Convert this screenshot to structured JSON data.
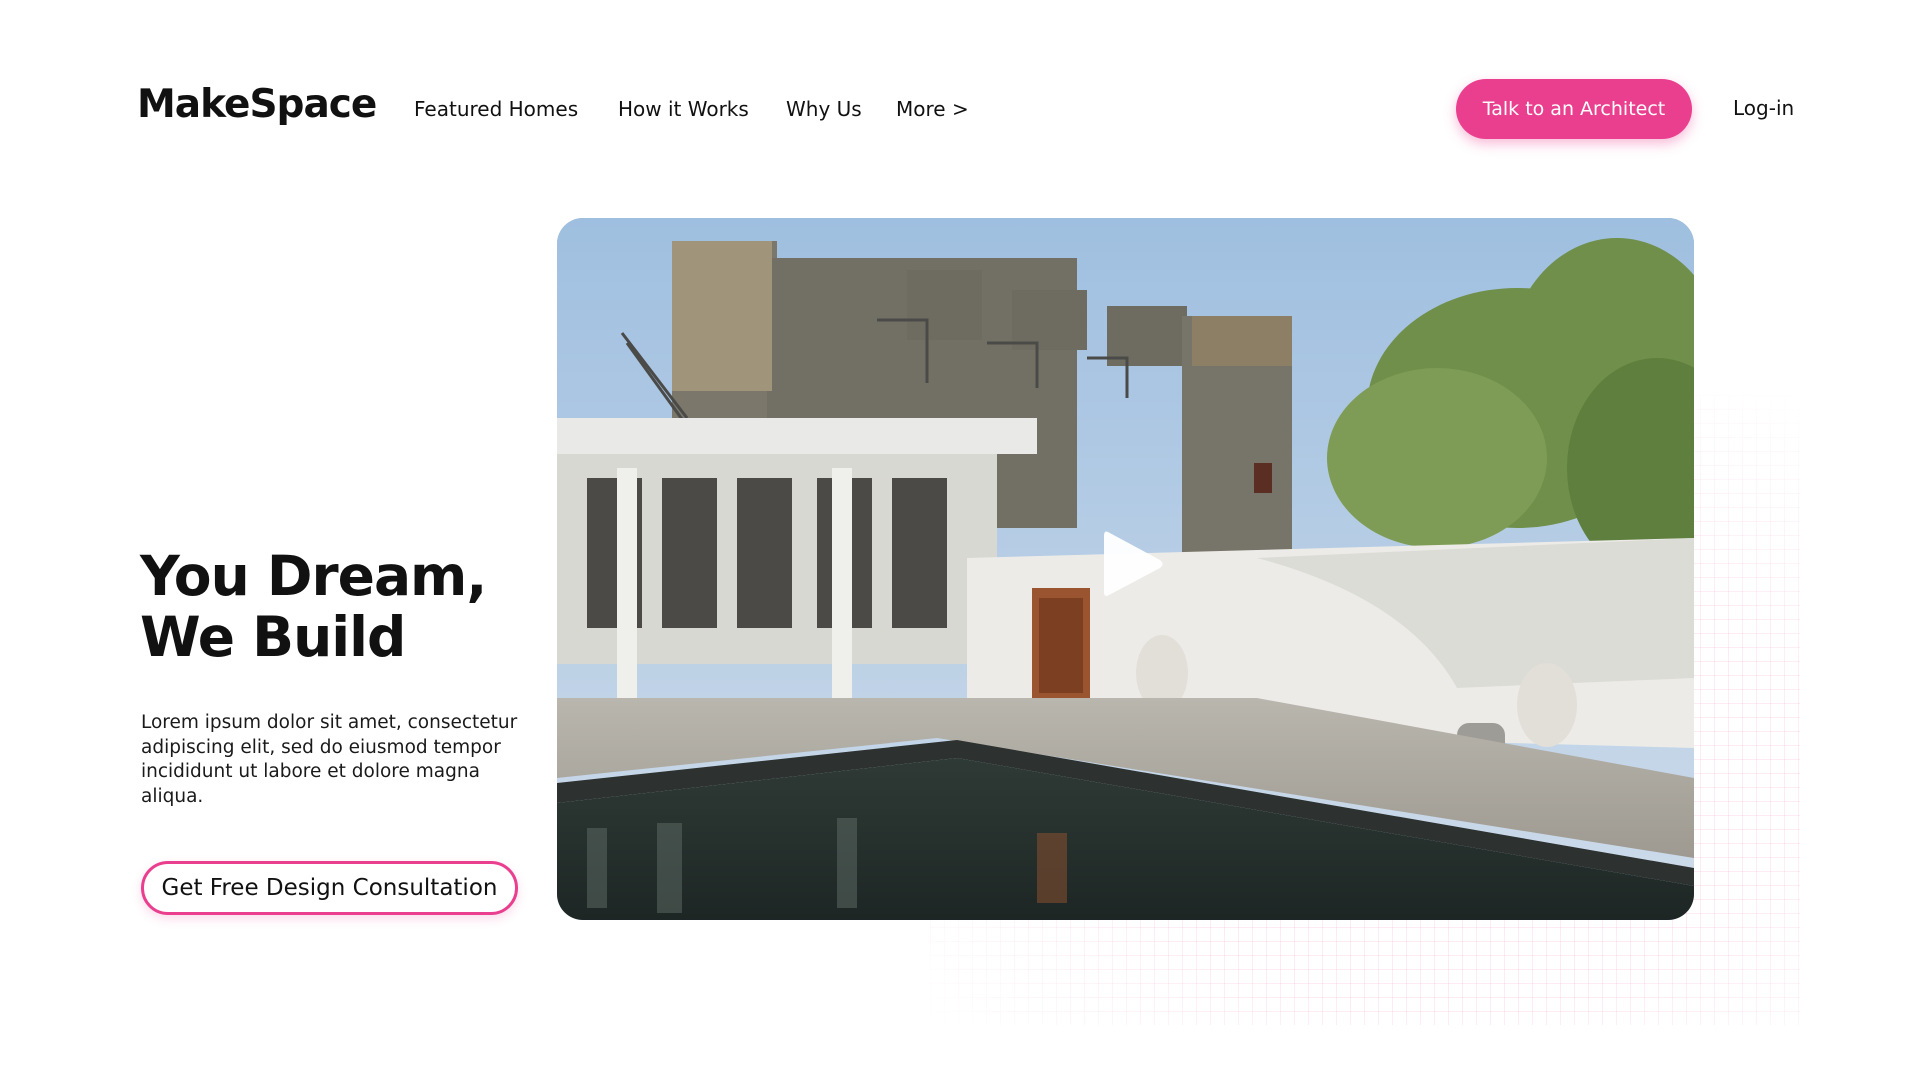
{
  "brand": {
    "name": "MakeSpace"
  },
  "nav": {
    "items": [
      {
        "label": "Featured Homes"
      },
      {
        "label": "How it Works"
      },
      {
        "label": "Why Us"
      },
      {
        "label": "More >"
      }
    ],
    "cta_label": "Talk to an Architect",
    "login_label": "Log-in"
  },
  "hero": {
    "title_line1": "You Dream,",
    "title_line2": "We Build",
    "body": "Lorem ipsum dolor sit amet, consectetur adipiscing elit, sed do eiusmod tempor incididunt ut labore et dolore magna aliqua.",
    "cta_label": "Get Free Design Consultation"
  },
  "media": {
    "play_icon": "play-icon",
    "image_subject": "house-with-pool-photo"
  },
  "colors": {
    "accent": "#ea3f8e",
    "text": "#111111",
    "background": "#ffffff"
  }
}
